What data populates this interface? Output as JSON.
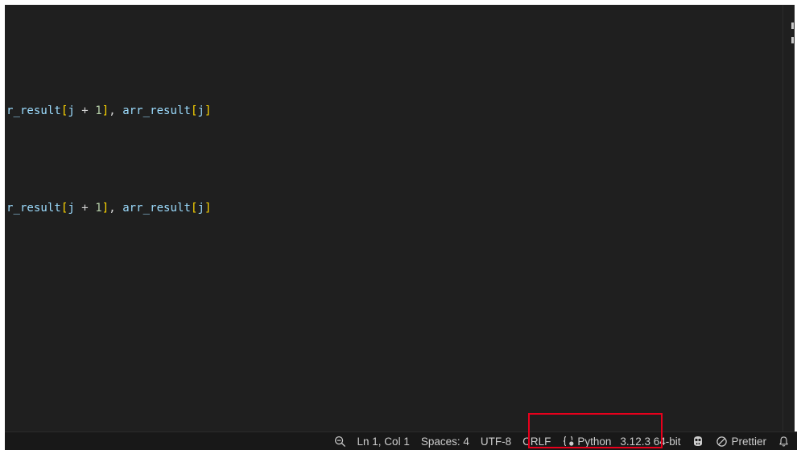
{
  "editor": {
    "lines": [
      {
        "tokens": [
          {
            "text": "r_result",
            "kind": "var"
          },
          {
            "text": "[",
            "kind": "br1"
          },
          {
            "text": "j",
            "kind": "var"
          },
          {
            "text": " + ",
            "kind": "op"
          },
          {
            "text": "1",
            "kind": "num"
          },
          {
            "text": "]",
            "kind": "br1"
          },
          {
            "text": ", ",
            "kind": "op"
          },
          {
            "text": "arr_result",
            "kind": "var"
          },
          {
            "text": "[",
            "kind": "br1"
          },
          {
            "text": "j",
            "kind": "var"
          },
          {
            "text": "]",
            "kind": "br1"
          }
        ]
      },
      {
        "tokens": [
          {
            "text": "r_result",
            "kind": "var"
          },
          {
            "text": "[",
            "kind": "br1"
          },
          {
            "text": "j",
            "kind": "var"
          },
          {
            "text": " + ",
            "kind": "op"
          },
          {
            "text": "1",
            "kind": "num"
          },
          {
            "text": "]",
            "kind": "br1"
          },
          {
            "text": ", ",
            "kind": "op"
          },
          {
            "text": "arr_result",
            "kind": "var"
          },
          {
            "text": "[",
            "kind": "br1"
          },
          {
            "text": "j",
            "kind": "var"
          },
          {
            "text": "]",
            "kind": "br1"
          }
        ]
      }
    ],
    "colors": {
      "background": "#1f1f1f",
      "variable": "#9cdcfe",
      "bracket": "#ffd700",
      "number": "#b5cea8",
      "operator": "#d4d4d4"
    }
  },
  "statusbar": {
    "zoom_icon": "zoom-out-icon",
    "cursor_position": "Ln 1, Col 1",
    "indentation": "Spaces: 4",
    "encoding": "UTF-8",
    "line_ending": "CRLF",
    "language_icon": "curly-braces-icon",
    "language": "Python",
    "interpreter": "3.12.3 64-bit",
    "copilot_icon": "copilot-icon",
    "prettier_icon": "prohibited-icon",
    "prettier": "Prettier",
    "notifications_icon": "bell-icon",
    "highlight_color": "#e8001c"
  }
}
